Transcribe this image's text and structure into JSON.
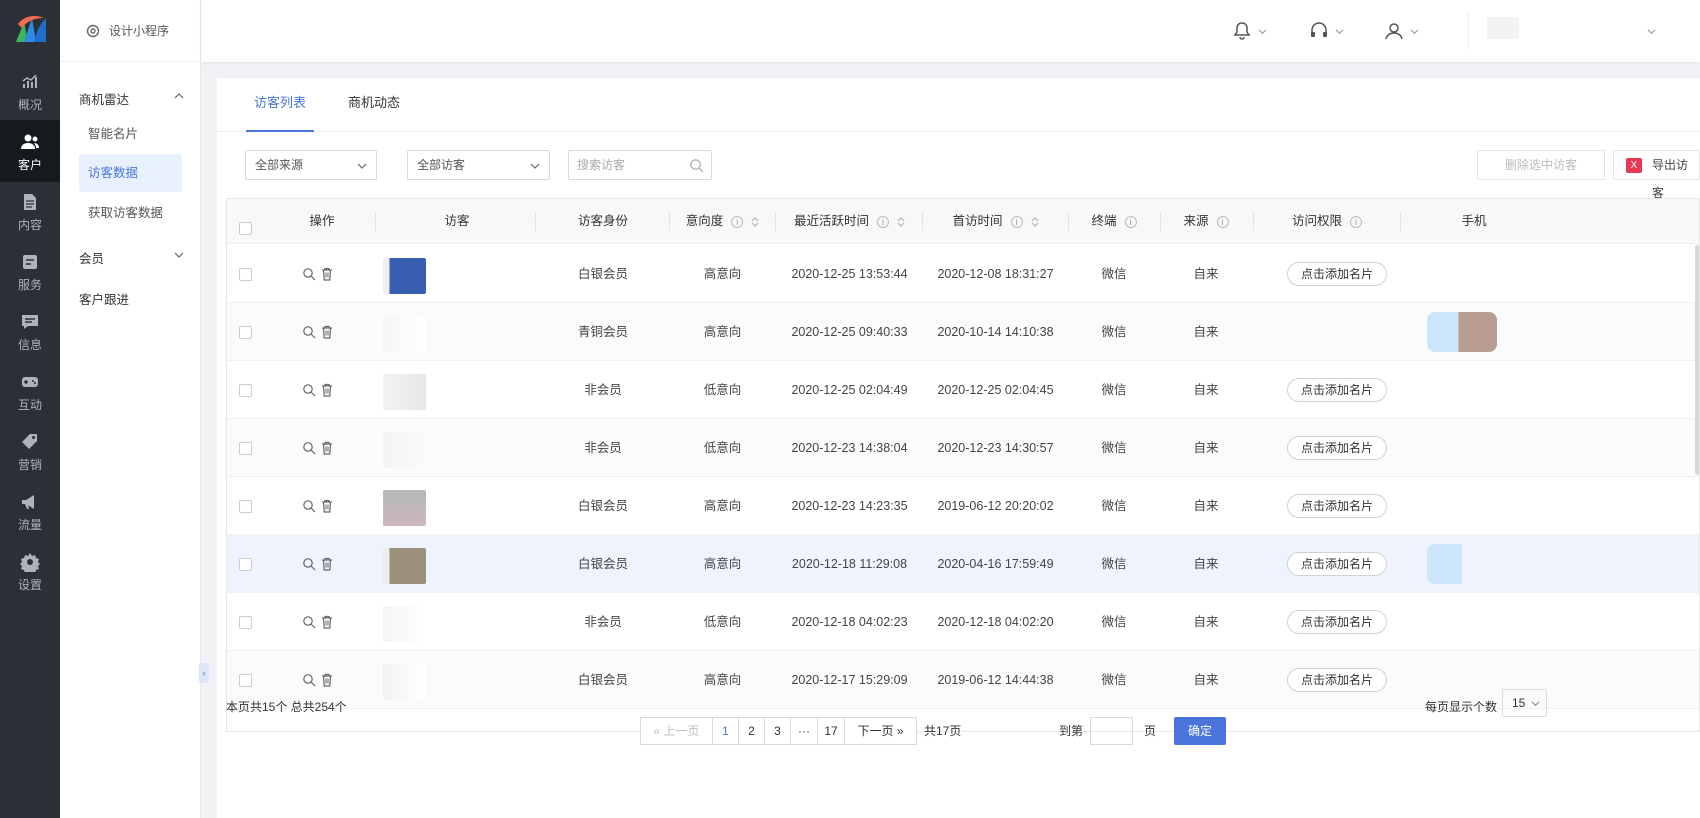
{
  "rail": {
    "items": [
      {
        "label": "概况",
        "icon": "chart-icon"
      },
      {
        "label": "客户",
        "icon": "users-icon"
      },
      {
        "label": "内容",
        "icon": "document-icon"
      },
      {
        "label": "服务",
        "icon": "service-icon"
      },
      {
        "label": "信息",
        "icon": "message-icon"
      },
      {
        "label": "互动",
        "icon": "gamepad-icon"
      },
      {
        "label": "营销",
        "icon": "tag-icon"
      },
      {
        "label": "流量",
        "icon": "megaphone-icon"
      },
      {
        "label": "设置",
        "icon": "gear-icon"
      }
    ]
  },
  "submenu": {
    "header": "设计小程序",
    "group1": "商机雷达",
    "items": [
      "智能名片",
      "访客数据",
      "获取访客数据"
    ],
    "group2": "会员",
    "item_follow": "客户跟进"
  },
  "tabs": [
    "访客列表",
    "商机动态"
  ],
  "filters": {
    "source": "全部来源",
    "visitors": "全部访客",
    "search_placeholder": "搜索访客",
    "delete_btn": "删除选中访客",
    "export_btn": "导出访客",
    "export_icon": "xls-icon"
  },
  "table": {
    "headers": [
      "操作",
      "访客",
      "访客身份",
      "意向度",
      "最近活跃时间",
      "首访时间",
      "终端",
      "来源",
      "访问权限",
      "手机"
    ],
    "add_card_label": "点击添加名片",
    "rows": [
      {
        "identity": "白银会员",
        "intent": "高意向",
        "recent": "2020-12-25 13:53:44",
        "first": "2020-12-08 18:31:27",
        "terminal": "微信",
        "source": "自来",
        "has_card": true
      },
      {
        "identity": "青铜会员",
        "intent": "高意向",
        "recent": "2020-12-25 09:40:33",
        "first": "2020-10-14 14:10:38",
        "terminal": "微信",
        "source": "自来",
        "has_card": false
      },
      {
        "identity": "非会员",
        "intent": "低意向",
        "recent": "2020-12-25 02:04:49",
        "first": "2020-12-25 02:04:45",
        "terminal": "微信",
        "source": "自来",
        "has_card": true
      },
      {
        "identity": "非会员",
        "intent": "低意向",
        "recent": "2020-12-23 14:38:04",
        "first": "2020-12-23 14:30:57",
        "terminal": "微信",
        "source": "自来",
        "has_card": true
      },
      {
        "identity": "白银会员",
        "intent": "高意向",
        "recent": "2020-12-23 14:23:35",
        "first": "2019-06-12 20:20:02",
        "terminal": "微信",
        "source": "自来",
        "has_card": true
      },
      {
        "identity": "白银会员",
        "intent": "高意向",
        "recent": "2020-12-18 11:29:08",
        "first": "2020-04-16 17:59:49",
        "terminal": "微信",
        "source": "自来",
        "has_card": true
      },
      {
        "identity": "非会员",
        "intent": "低意向",
        "recent": "2020-12-18 04:02:23",
        "first": "2020-12-18 04:02:20",
        "terminal": "微信",
        "source": "自来",
        "has_card": true
      },
      {
        "identity": "白银会员",
        "intent": "高意向",
        "recent": "2020-12-17 15:29:09",
        "first": "2019-06-12 14:44:38",
        "terminal": "微信",
        "source": "自来",
        "has_card": true
      }
    ]
  },
  "footer": {
    "summary": "本页共15个  总共254个",
    "prev": "上一页",
    "next": "下一页",
    "pages": [
      "1",
      "2",
      "3",
      "···",
      "17"
    ],
    "total_pages": "共17页",
    "goto_label": "到第",
    "page_unit": "页",
    "confirm": "确定",
    "per_page_label": "每页显示个数",
    "per_page_value": "15"
  },
  "colors": {
    "accent": "#4a74d9",
    "rail": "#2b3036",
    "export_icon": "#e53954"
  }
}
